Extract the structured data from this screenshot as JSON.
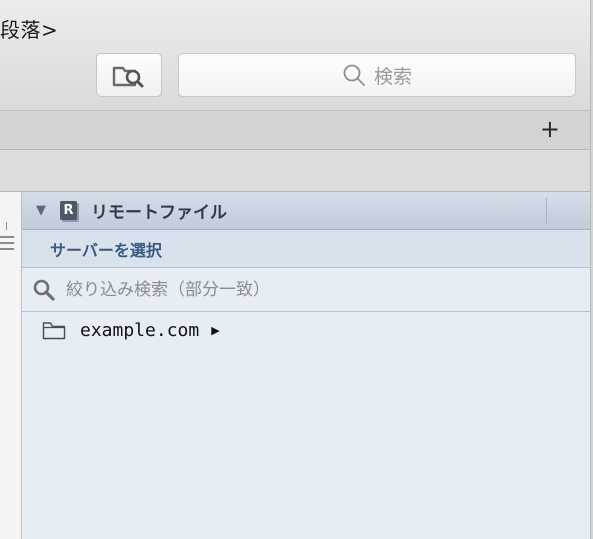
{
  "window": {
    "doc_title": "段落>"
  },
  "toolbar": {
    "search_placeholder": "検索",
    "tool_button_icon": "folder-search-icon"
  },
  "tabbar": {
    "add_label": "+"
  },
  "remote_panel": {
    "badge": "R",
    "title": "リモートファイル",
    "server_select": "サーバーを選択",
    "filter_placeholder": "絞り込み検索（部分一致）",
    "files": [
      {
        "name": "example.com",
        "type": "folder",
        "has_children": true
      }
    ]
  },
  "colors": {
    "panel_bg": "#e6edf5",
    "header_bg": "#c8d3df",
    "link_blue": "#3a5a82"
  }
}
